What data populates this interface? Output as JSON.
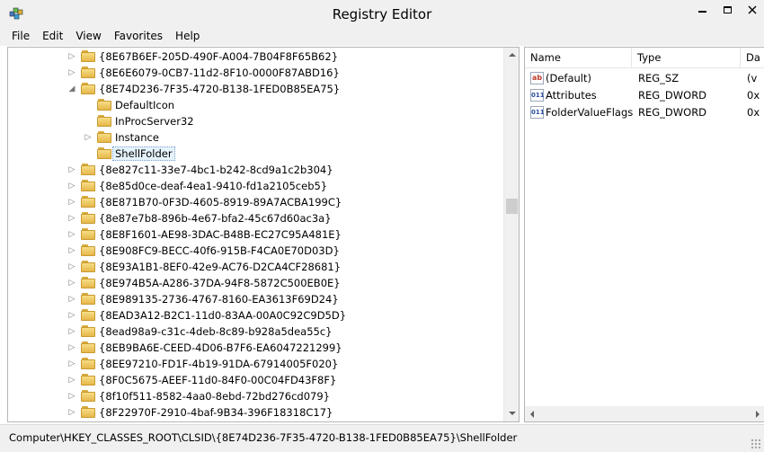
{
  "window": {
    "title": "Registry Editor"
  },
  "menu": [
    "File",
    "Edit",
    "View",
    "Favorites",
    "Help"
  ],
  "tree": [
    {
      "label": "{8E67B6EF-205D-490F-A004-7B04F8F65B62}",
      "level": 0,
      "expander": "collapsed"
    },
    {
      "label": "{8E6E6079-0CB7-11d2-8F10-0000F87ABD16}",
      "level": 0,
      "expander": "collapsed"
    },
    {
      "label": "{8E74D236-7F35-4720-B138-1FED0B85EA75}",
      "level": 0,
      "expander": "expanded"
    },
    {
      "label": "DefaultIcon",
      "level": 1,
      "expander": "none"
    },
    {
      "label": "InProcServer32",
      "level": 1,
      "expander": "none"
    },
    {
      "label": "Instance",
      "level": 1,
      "expander": "collapsed"
    },
    {
      "label": "ShellFolder",
      "level": 1,
      "expander": "none",
      "selected": true
    },
    {
      "label": "{8e827c11-33e7-4bc1-b242-8cd9a1c2b304}",
      "level": 0,
      "expander": "collapsed"
    },
    {
      "label": "{8e85d0ce-deaf-4ea1-9410-fd1a2105ceb5}",
      "level": 0,
      "expander": "collapsed"
    },
    {
      "label": "{8E871B70-0F3D-4605-8919-89A7ACBA199C}",
      "level": 0,
      "expander": "collapsed"
    },
    {
      "label": "{8e87e7b8-896b-4e67-bfa2-45c67d60ac3a}",
      "level": 0,
      "expander": "collapsed"
    },
    {
      "label": "{8E8F1601-AE98-3DAC-B48B-EC27C95A481E}",
      "level": 0,
      "expander": "collapsed"
    },
    {
      "label": "{8E908FC9-BECC-40f6-915B-F4CA0E70D03D}",
      "level": 0,
      "expander": "collapsed"
    },
    {
      "label": "{8E93A1B1-8EF0-42e9-AC76-D2CA4CF28681}",
      "level": 0,
      "expander": "collapsed"
    },
    {
      "label": "{8E974B5A-A286-37DA-94F8-5872C500EB0E}",
      "level": 0,
      "expander": "collapsed"
    },
    {
      "label": "{8E989135-2736-4767-8160-EA3613F69D24}",
      "level": 0,
      "expander": "collapsed"
    },
    {
      "label": "{8EAD3A12-B2C1-11d0-83AA-00A0C92C9D5D}",
      "level": 0,
      "expander": "collapsed"
    },
    {
      "label": "{8ead98a9-c31c-4deb-8c89-b928a5dea55c}",
      "level": 0,
      "expander": "collapsed"
    },
    {
      "label": "{8EB9BA6E-CEED-4D06-B7F6-EA6047221299}",
      "level": 0,
      "expander": "collapsed"
    },
    {
      "label": "{8EE97210-FD1F-4b19-91DA-67914005F020}",
      "level": 0,
      "expander": "collapsed"
    },
    {
      "label": "{8F0C5675-AEEF-11d0-84F0-00C04FD43F8F}",
      "level": 0,
      "expander": "collapsed"
    },
    {
      "label": "{8f10f511-8582-4aa0-8ebd-72bd276cd079}",
      "level": 0,
      "expander": "collapsed"
    },
    {
      "label": "{8F22970F-2910-4baf-9B34-396F18318C17}",
      "level": 0,
      "expander": "collapsed"
    }
  ],
  "list": {
    "columns": [
      "Name",
      "Type",
      "Da"
    ],
    "rows": [
      {
        "icon": "string-value-icon",
        "name": "(Default)",
        "type": "REG_SZ",
        "data": "(v"
      },
      {
        "icon": "dword-value-icon",
        "name": "Attributes",
        "type": "REG_DWORD",
        "data": "0x"
      },
      {
        "icon": "dword-value-icon",
        "name": "FolderValueFlags",
        "type": "REG_DWORD",
        "data": "0x"
      }
    ]
  },
  "status": {
    "path": "Computer\\HKEY_CLASSES_ROOT\\CLSID\\{8E74D236-7F35-4720-B138-1FED0B85EA75}\\ShellFolder"
  }
}
